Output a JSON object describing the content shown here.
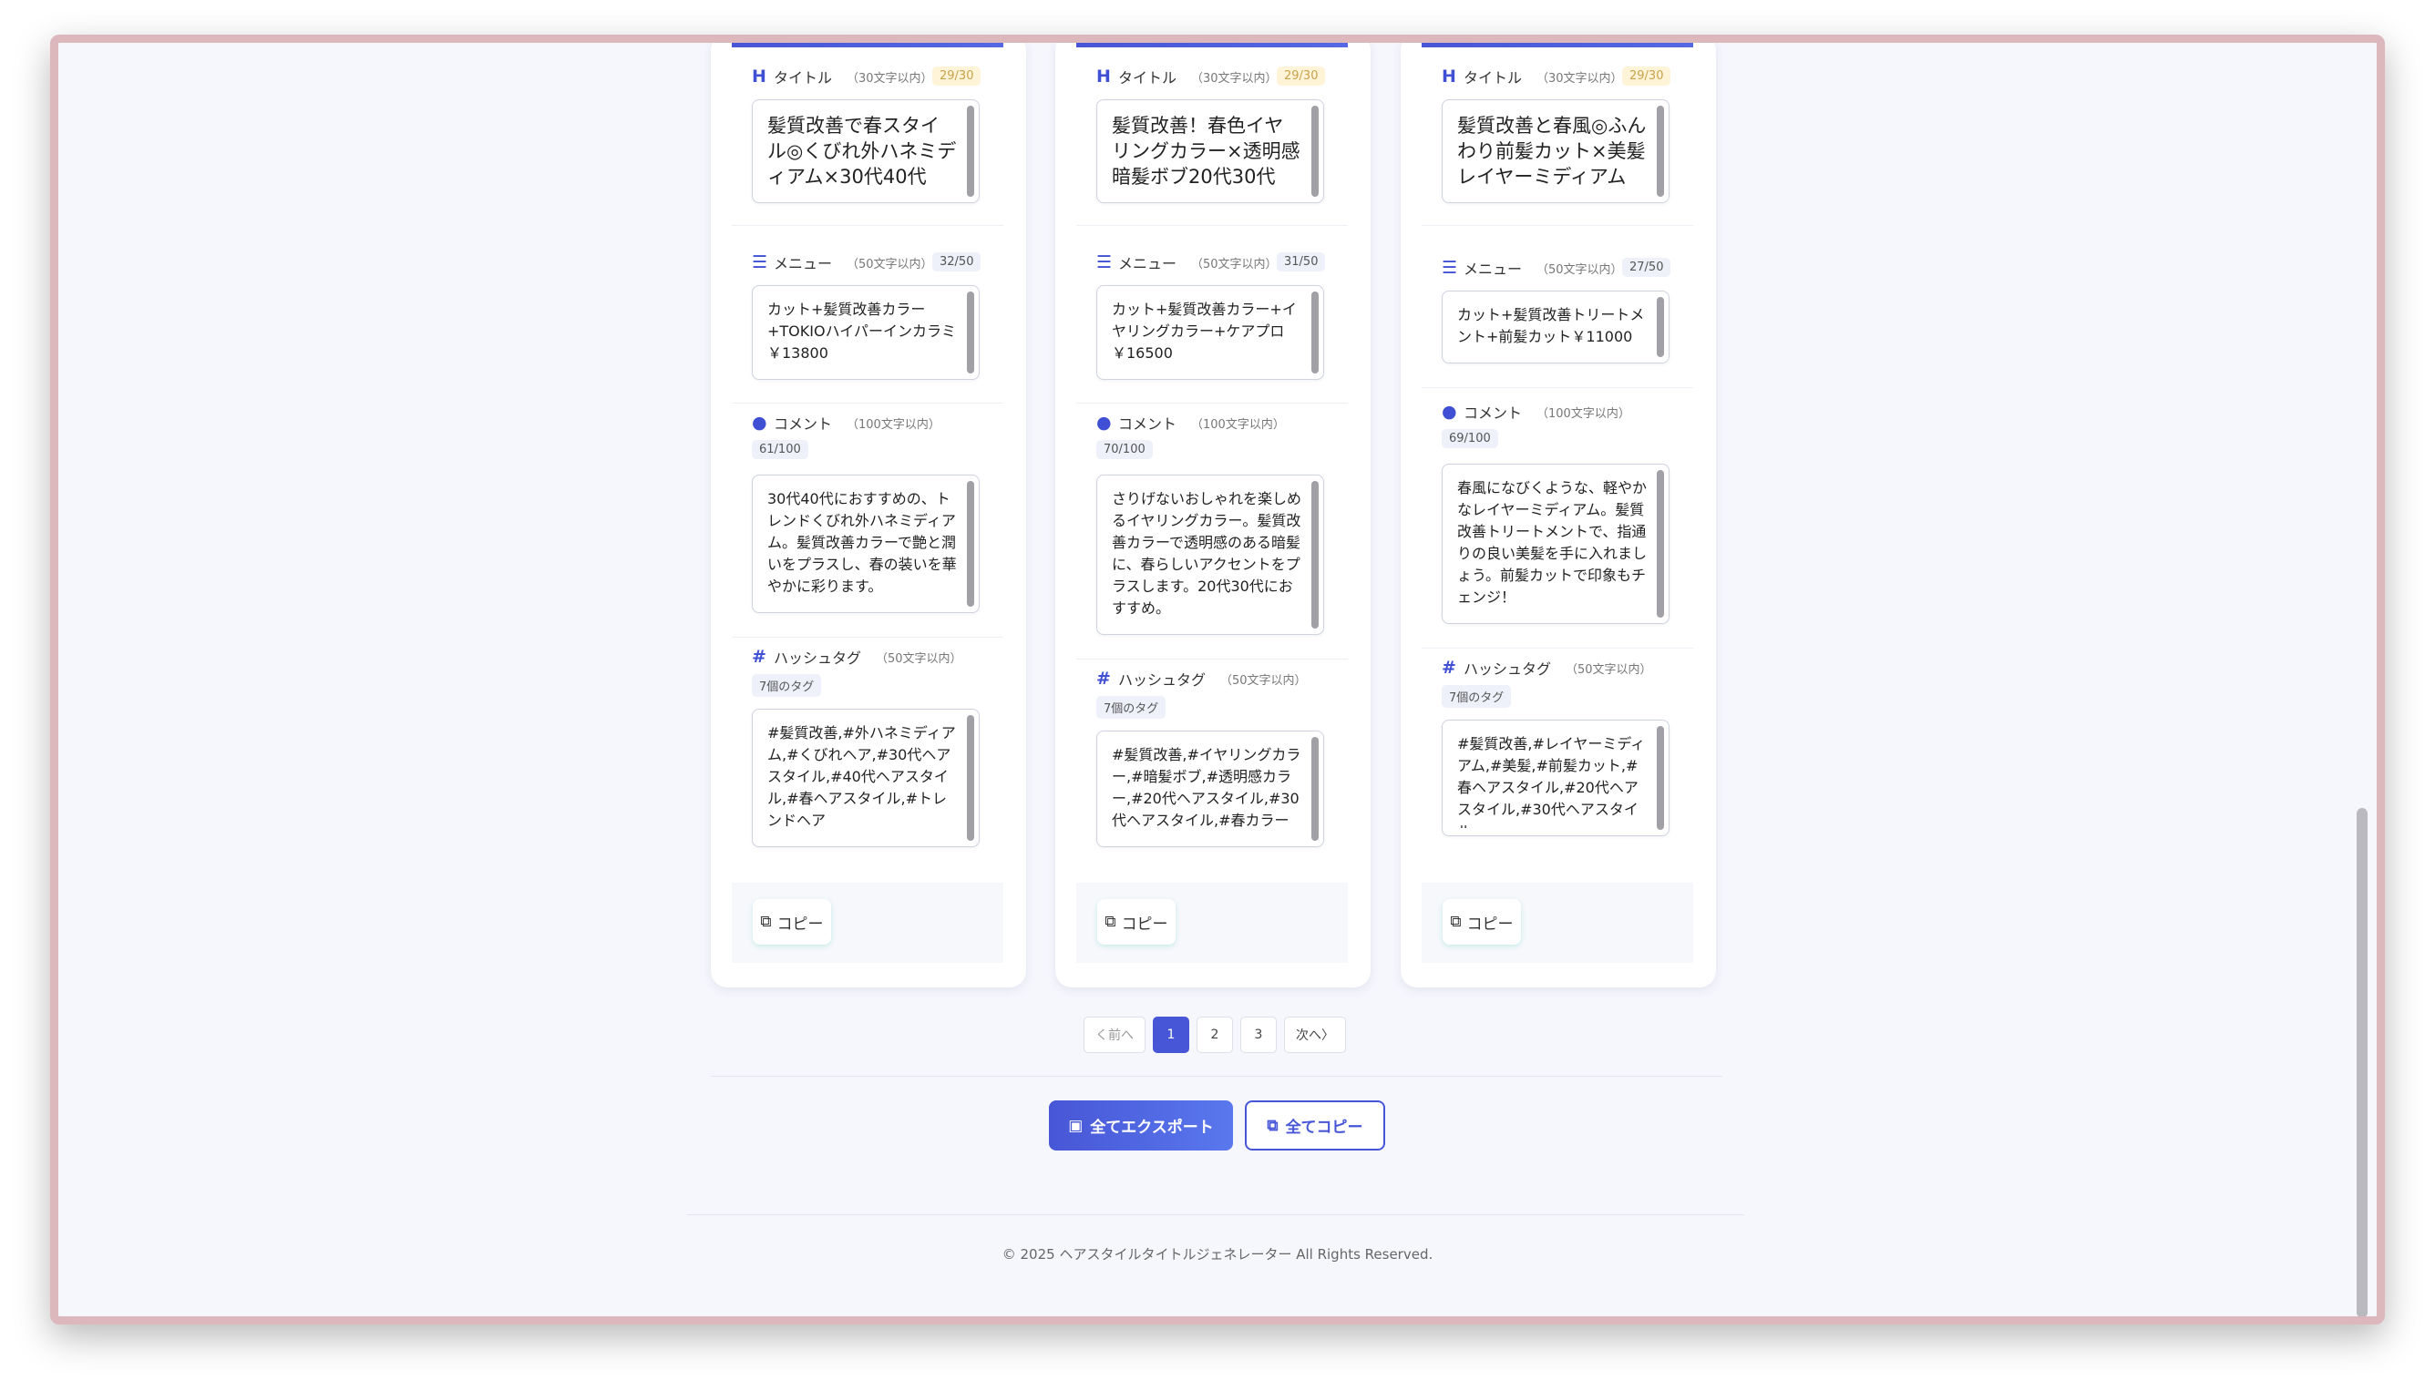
{
  "cards": [
    {
      "title_label": "タイトル",
      "title_limit": "（30文字以内）",
      "title_count": "29/30",
      "title_text": "髪質改善で春スタイル◎くびれ外ハネミディアム×30代40代",
      "menu_label": "メニュー",
      "menu_limit": "（50文字以内）",
      "menu_count": "32/50",
      "menu_text": "カット+髪質改善カラー+TOKIOハイパーインカラミ￥13800",
      "comment_label": "コメント",
      "comment_limit": "（100文字以内）",
      "comment_count": "61/100",
      "comment_text": "30代40代におすすめの、トレンドくびれ外ハネミディアム。髪質改善カラーで艶と潤いをプラスし、春の装いを華やかに彩ります。",
      "hashtag_label": "ハッシュタグ",
      "hashtag_limit": "（50文字以内）",
      "hashtag_count": "7個のタグ",
      "hashtag_text": "#髪質改善,#外ハネミディアム,#くびれヘア,#30代ヘアスタイル,#40代ヘアスタイル,#春ヘアスタイル,#トレンドヘア",
      "copy_label": "コピー"
    },
    {
      "title_label": "タイトル",
      "title_limit": "（30文字以内）",
      "title_count": "29/30",
      "title_text": "髪質改善！春色イヤリングカラー×透明感暗髪ボブ20代30代",
      "menu_label": "メニュー",
      "menu_limit": "（50文字以内）",
      "menu_count": "31/50",
      "menu_text": "カット+髪質改善カラー+イヤリングカラー+ケアプロ￥16500",
      "comment_label": "コメント",
      "comment_limit": "（100文字以内）",
      "comment_count": "70/100",
      "comment_text": "さりげないおしゃれを楽しめるイヤリングカラー。髪質改善カラーで透明感のある暗髪に、春らしいアクセントをプラスします。20代30代におすすめ。",
      "hashtag_label": "ハッシュタグ",
      "hashtag_limit": "（50文字以内）",
      "hashtag_count": "7個のタグ",
      "hashtag_text": "#髪質改善,#イヤリングカラー,#暗髪ボブ,#透明感カラー,#20代ヘアスタイル,#30代ヘアスタイル,#春カラー",
      "copy_label": "コピー"
    },
    {
      "title_label": "タイトル",
      "title_limit": "（30文字以内）",
      "title_count": "29/30",
      "title_text": "髪質改善と春風◎ふんわり前髪カット×美髪レイヤーミディアム",
      "menu_label": "メニュー",
      "menu_limit": "（50文字以内）",
      "menu_count": "27/50",
      "menu_text": "カット+髪質改善トリートメント+前髪カット￥11000",
      "comment_label": "コメント",
      "comment_limit": "（100文字以内）",
      "comment_count": "69/100",
      "comment_text": "春風になびくような、軽やかなレイヤーミディアム。髪質改善トリートメントで、指通りの良い美髪を手に入れましょう。前髪カットで印象もチェンジ！",
      "hashtag_label": "ハッシュタグ",
      "hashtag_limit": "（50文字以内）",
      "hashtag_count": "7個のタグ",
      "hashtag_text": "#髪質改善,#レイヤーミディアム,#美髪,#前髪カット,#春ヘアスタイル,#20代ヘアスタイル,#30代ヘアスタイル",
      "copy_label": "コピー"
    }
  ],
  "pagination": {
    "prev": "く前へ",
    "pages": [
      "1",
      "2",
      "3"
    ],
    "next": "次へ〉"
  },
  "actions": {
    "export_all": "全てエクスポート",
    "copy_all": "全てコピー"
  },
  "footer": "© 2025 ヘアスタイルタイトルジェネレーター All Rights Reserved.",
  "colors": {
    "accent": "#4756d6",
    "background": "#f6f7fd"
  }
}
